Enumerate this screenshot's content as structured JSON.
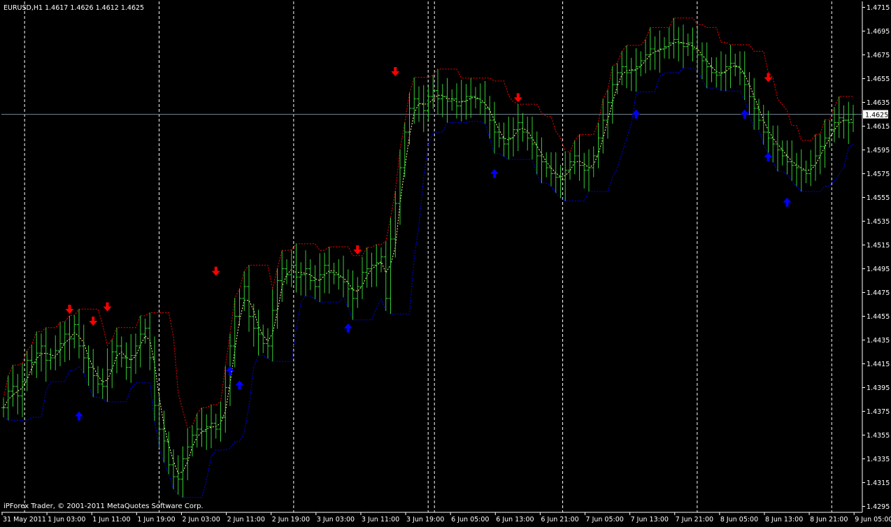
{
  "chart_data": {
    "type": "line",
    "title": "EURUSD,H1  1.4617 1.4626 1.4612 1.4625",
    "watermark": "iPForex Trader, © 2001-2011 MetaQuotes Software Corp.",
    "current_price_label": "1.4625",
    "current_price": 1.4625,
    "ylim": [
      1.429,
      1.472
    ],
    "y_ticks": [
      "1.4715",
      "1.4695",
      "1.4675",
      "1.4655",
      "1.4635",
      "1.4615",
      "1.4595",
      "1.4575",
      "1.4555",
      "1.4535",
      "1.4515",
      "1.4495",
      "1.4475",
      "1.4455",
      "1.4435",
      "1.4415",
      "1.4395",
      "1.4375",
      "1.4355",
      "1.4335",
      "1.4315",
      "1.4295"
    ],
    "x_ticks": [
      "31 May 2011",
      "1 Jun 03:00",
      "1 Jun 11:00",
      "1 Jun 19:00",
      "2 Jun 03:00",
      "2 Jun 11:00",
      "2 Jun 19:00",
      "3 Jun 03:00",
      "3 Jun 11:00",
      "3 Jun 19:00",
      "6 Jun 05:00",
      "6 Jun 13:00",
      "6 Jun 21:00",
      "7 Jun 05:00",
      "7 Jun 13:00",
      "7 Jun 21:00",
      "8 Jun 05:00",
      "8 Jun 13:00",
      "8 Jun 21:00",
      "9 Jun 05:00"
    ],
    "day_separators_after_tick": [
      0,
      3,
      6,
      9,
      9,
      12,
      15,
      18
    ],
    "colors": {
      "background": "#000000",
      "axis": "#ffffff",
      "bars": "#32cd32",
      "upper_band": "#ff0000",
      "lower_band": "#0000ff",
      "middle_line": "#ffff99",
      "up_arrow": "#0000ff",
      "down_arrow": "#ff0000",
      "price_line": "#708090"
    },
    "close_series": [
      1.4378,
      1.4392,
      1.4396,
      1.4388,
      1.44,
      1.4418,
      1.4416,
      1.4424,
      1.443,
      1.4418,
      1.442,
      1.4426,
      1.4432,
      1.444,
      1.4436,
      1.4448,
      1.443,
      1.442,
      1.4412,
      1.4405,
      1.4398,
      1.4396,
      1.441,
      1.4425,
      1.443,
      1.442,
      1.4412,
      1.4422,
      1.443,
      1.444,
      1.4445,
      1.442,
      1.438,
      1.436,
      1.435,
      1.433,
      1.432,
      1.4318,
      1.4335,
      1.4345,
      1.4355,
      1.436,
      1.4358,
      1.4362,
      1.4365,
      1.436,
      1.437,
      1.4395,
      1.443,
      1.4455,
      1.447,
      1.448,
      1.4455,
      1.4445,
      1.444,
      1.4432,
      1.443,
      1.446,
      1.4485,
      1.4495,
      1.449,
      1.4498,
      1.4488,
      1.449,
      1.4495,
      1.4485,
      1.448,
      1.449,
      1.4498,
      1.4492,
      1.449,
      1.4488,
      1.4484,
      1.4478,
      1.447,
      1.448,
      1.4492,
      1.4495,
      1.4498,
      1.45,
      1.4505,
      1.447,
      1.452,
      1.455,
      1.458,
      1.461,
      1.463,
      1.4638,
      1.4634,
      1.4628,
      1.464,
      1.4645,
      1.4638,
      1.464,
      1.4636,
      1.4638,
      1.4632,
      1.4636,
      1.464,
      1.464,
      1.4638,
      1.4635,
      1.463,
      1.462,
      1.461,
      1.4605,
      1.46,
      1.4605,
      1.4612,
      1.4618,
      1.461,
      1.4605,
      1.46,
      1.459,
      1.4585,
      1.458,
      1.4575,
      1.4572,
      1.457,
      1.4578,
      1.4585,
      1.459,
      1.4582,
      1.4578,
      1.458,
      1.459,
      1.4605,
      1.462,
      1.4635,
      1.465,
      1.466,
      1.4665,
      1.466,
      1.4662,
      1.4665,
      1.467,
      1.4675,
      1.468,
      1.4678,
      1.468,
      1.4682,
      1.4685,
      1.4688,
      1.4685,
      1.4682,
      1.4685,
      1.468,
      1.4675,
      1.467,
      1.4665,
      1.466,
      1.4658,
      1.466,
      1.4665,
      1.4668,
      1.4665,
      1.466,
      1.465,
      1.464,
      1.463,
      1.462,
      1.461,
      1.4605,
      1.46,
      1.4595,
      1.459,
      1.4585,
      1.4582,
      1.458,
      1.4578,
      1.4575,
      1.4582,
      1.459,
      1.4598,
      1.4605,
      1.4612,
      1.4618,
      1.4622,
      1.462,
      1.4618,
      1.4625
    ],
    "down_arrows": [
      {
        "x_index": 14,
        "price": 1.446
      },
      {
        "x_index": 19,
        "price": 1.445
      },
      {
        "x_index": 22,
        "price": 1.4462
      },
      {
        "x_index": 45,
        "price": 1.4492
      },
      {
        "x_index": 75,
        "price": 1.451
      },
      {
        "x_index": 83,
        "price": 1.466
      },
      {
        "x_index": 109,
        "price": 1.4638
      },
      {
        "x_index": 162,
        "price": 1.4655
      }
    ],
    "up_arrows": [
      {
        "x_index": 16,
        "price": 1.4372
      },
      {
        "x_index": 48,
        "price": 1.441
      },
      {
        "x_index": 50,
        "price": 1.4398
      },
      {
        "x_index": 73,
        "price": 1.4446
      },
      {
        "x_index": 104,
        "price": 1.4576
      },
      {
        "x_index": 134,
        "price": 1.4626
      },
      {
        "x_index": 157,
        "price": 1.4626
      },
      {
        "x_index": 162,
        "price": 1.459
      },
      {
        "x_index": 166,
        "price": 1.4552
      }
    ]
  }
}
